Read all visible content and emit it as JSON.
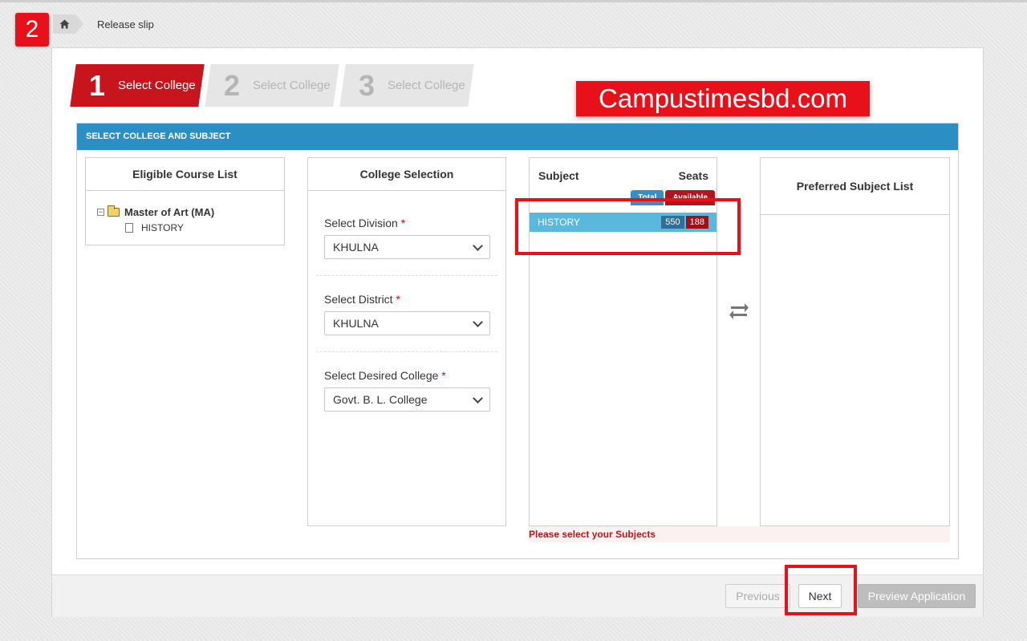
{
  "step_marker": "2",
  "breadcrumb": {
    "home_icon": "home-icon",
    "current": "Release slip"
  },
  "wizard": [
    {
      "num": "1",
      "label": "Select College",
      "active": true
    },
    {
      "num": "2",
      "label": "Select College",
      "active": false
    },
    {
      "num": "3",
      "label": "Select College",
      "active": false
    }
  ],
  "watermark": "Campustimesbd.com",
  "panel": {
    "title": "SELECT COLLEGE AND SUBJECT",
    "course_list": {
      "title": "Eligible Course List",
      "course": "Master of Art (MA)",
      "subject": "HISTORY"
    },
    "college_selection": {
      "title": "College Selection",
      "division": {
        "label": "Select Division",
        "value": "KHULNA"
      },
      "district": {
        "label": "Select District",
        "value": "KHULNA"
      },
      "college": {
        "label": "Select Desired College",
        "value": "Govt. B. L. College"
      },
      "required_mark": "*"
    },
    "subjects": {
      "subject_header": "Subject",
      "seats_header": "Seats",
      "legend_total": "Total",
      "legend_available": "Available",
      "rows": [
        {
          "name": "HISTORY",
          "total": "550",
          "available": "188"
        }
      ]
    },
    "preferred": {
      "title": "Preferred Subject List"
    },
    "warning": "Please select your Subjects"
  },
  "footer": {
    "previous": "Previous",
    "next": "Next",
    "preview": "Preview Application"
  },
  "colors": {
    "accent_red": "#c8141c",
    "header_blue": "#2b8fc3",
    "subject_row": "#5ab8dd",
    "highlight": "#e8111a"
  }
}
